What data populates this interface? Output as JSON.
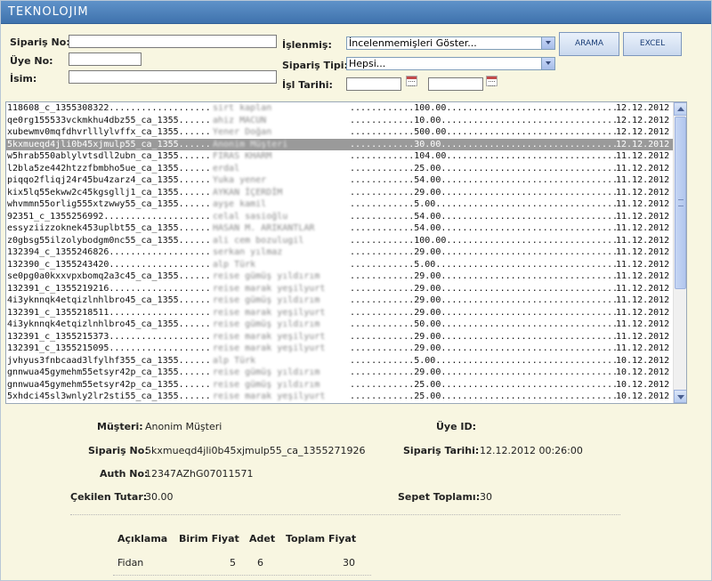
{
  "app": {
    "logo": "TEKNOLOJIM"
  },
  "search": {
    "siparis_no_label": "Sipariş No:",
    "uye_no_label": "Üye No:",
    "isim_label": "İsim:",
    "islenmis_label": "İşlenmiş:",
    "islenmis_value": "İncelenmemişleri Göster...",
    "siparis_tipi_label": "Sipariş Tipi:",
    "siparis_tipi_value": "Hepsi...",
    "isl_tarihi_label": "İşl Tarihi:",
    "search_button": "ARAMA",
    "excel_button": "EXCEL"
  },
  "orders": [
    {
      "order_no": "118608_c_1355308322",
      "name": "sirt kaplan",
      "amount": "100.00",
      "date": "12.12.2012"
    },
    {
      "order_no": "qe0rg155533vckmkhu4dbz55_ca_1355..",
      "name": "ahiz MACUN",
      "amount": "10.00",
      "date": "12.12.2012"
    },
    {
      "order_no": "xubewmv0mqfdhvrlllylvffx_ca_1355..",
      "name": "Yener Doğan",
      "amount": "500.00",
      "date": "12.12.2012"
    },
    {
      "order_no": "5kxmueqd4jli0b45xjmulp55_ca_1355..",
      "name": "Anonim Müşteri",
      "amount": "30.00",
      "date": "12.12.2012",
      "selected": true
    },
    {
      "order_no": "w5hrab550ablylvtsdll2ubn_ca_1355..",
      "name": "FIRAS KHARM",
      "amount": "104.00",
      "date": "11.12.2012"
    },
    {
      "order_no": "l2bla5ze442htzzfbmbho5ue_ca_1355..",
      "name": "erdal",
      "amount": "25.00",
      "date": "11.12.2012"
    },
    {
      "order_no": "piqqo2fliqj24r45bu4zarz4_ca_1355..",
      "name": "Yuka yener",
      "amount": "54.00",
      "date": "11.12.2012"
    },
    {
      "order_no": "kix5lq55ekww2c45kgsgllj1_ca_1355..",
      "name": "AYKAN İÇERDİM",
      "amount": "29.00",
      "date": "11.12.2012"
    },
    {
      "order_no": "whvmmn55orlig555xtzwwy55_ca_1355..",
      "name": "ayşe kamil",
      "amount": "5.00",
      "date": "11.12.2012"
    },
    {
      "order_no": "92351_c_1355256992",
      "name": "celal sasioğlu",
      "amount": "54.00",
      "date": "11.12.2012"
    },
    {
      "order_no": "essyziizzoknek453uplbt55_ca_1355..",
      "name": "HASAN M. ARIKANTLAR",
      "amount": "54.00",
      "date": "11.12.2012"
    },
    {
      "order_no": "z0gbsg55ilzolybodgm0nc55_ca_1355..",
      "name": "ali cem bozulugil",
      "amount": "100.00",
      "date": "11.12.2012"
    },
    {
      "order_no": "132394_c_1355246826",
      "name": "serkan yılmaz",
      "amount": "29.00",
      "date": "11.12.2012"
    },
    {
      "order_no": "132390_c_1355243420",
      "name": "alp Türk",
      "amount": "5.00",
      "date": "11.12.2012"
    },
    {
      "order_no": "se0pg0a0kxxvpxbomq2a3c45_ca_1355..",
      "name": "reise gümüş yıldırım",
      "amount": "29.00",
      "date": "11.12.2012"
    },
    {
      "order_no": "132391_c_1355219216",
      "name": "reise marak yeşilyurt",
      "amount": "29.00",
      "date": "11.12.2012"
    },
    {
      "order_no": "4i3yknnqk4etqizlnhlbro45_ca_1355..",
      "name": "reise gümüş yıldırım",
      "amount": "29.00",
      "date": "11.12.2012"
    },
    {
      "order_no": "132391_c_1355218511",
      "name": "reise marak yeşilyurt",
      "amount": "29.00",
      "date": "11.12.2012"
    },
    {
      "order_no": "4i3yknnqk4etqizlnhlbro45_ca_1355..",
      "name": "reise gümüş yıldırım",
      "amount": "50.00",
      "date": "11.12.2012"
    },
    {
      "order_no": "132391_c_1355215373",
      "name": "reise marak yeşilyurt",
      "amount": "29.00",
      "date": "11.12.2012"
    },
    {
      "order_no": "132391_c_1355215095",
      "name": "reise marak yeşilyurt",
      "amount": "29.00",
      "date": "11.12.2012"
    },
    {
      "order_no": "jvhyus3fnbcaad3lfylhf355_ca_1355..",
      "name": "alp Türk",
      "amount": "5.00",
      "date": "10.12.2012"
    },
    {
      "order_no": "gnnwua45gymehm55etsyr42p_ca_1355..",
      "name": "reise gümüş yıldırım",
      "amount": "29.00",
      "date": "10.12.2012"
    },
    {
      "order_no": "gnnwua45gymehm55etsyr42p_ca_1355..",
      "name": "reise gümüş yıldırım",
      "amount": "25.00",
      "date": "10.12.2012"
    },
    {
      "order_no": "5xhdci45sl3wnly2lr2sti55_ca_1355..",
      "name": "reise marak yeşilyurt",
      "amount": "25.00",
      "date": "10.12.2012"
    }
  ],
  "detail": {
    "musteri_label": "Müşteri:",
    "musteri_value": "Anonim Müşteri",
    "uye_id_label": "Üye ID:",
    "uye_id_value": "",
    "siparis_no_label": "Sipariş No:",
    "siparis_no_value": "5kxmueqd4jli0b45xjmulp55_ca_1355271926",
    "siparis_tarihi_label": "Sipariş Tarihi:",
    "siparis_tarihi_value": "12.12.2012 00:26:00",
    "auth_no_label": "Auth No:",
    "auth_no_value": "12347AZhG07011571",
    "cekilen_tutar_label": "Çekilen Tutar:",
    "cekilen_tutar_value": "30.00",
    "sepet_toplami_label": "Sepet Toplamı:",
    "sepet_toplami_value": "30"
  },
  "items_table": {
    "headers": {
      "aciklama": "Açıklama",
      "birim_fiyat": "Birim Fiyat",
      "adet": "Adet",
      "toplam_fiyat": "Toplam Fiyat"
    },
    "rows": [
      {
        "aciklama": "Fidan",
        "birim_fiyat": "5",
        "adet": "6",
        "toplam_fiyat": "30"
      }
    ]
  },
  "scroll_position": 0.0
}
